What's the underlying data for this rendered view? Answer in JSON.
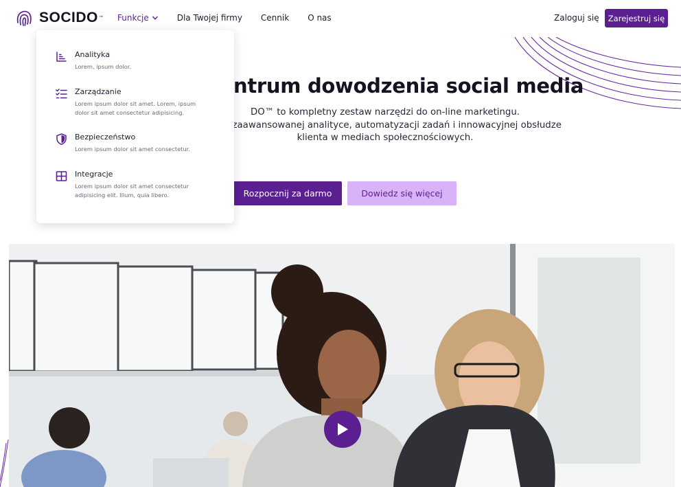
{
  "brand": {
    "name": "SOCIDO",
    "trademark": "™"
  },
  "nav": {
    "items": [
      {
        "label": "Funkcje"
      },
      {
        "label": "Dla Twojej firmy"
      },
      {
        "label": "Cennik"
      },
      {
        "label": "O nas"
      }
    ],
    "login_label": "Zaloguj się",
    "signup_label": "Zarejestruj się"
  },
  "dropdown": {
    "items": [
      {
        "title": "Analityka",
        "desc": "Lorem, ipsum dolor.",
        "icon": "chart-icon"
      },
      {
        "title": "Zarządzanie",
        "desc": "Lorem ipsum dolor sit amet. Lorem, ipsum dolor sit amet consectetur adipisicing.",
        "icon": "checklist-icon"
      },
      {
        "title": "Bezpieczeństwo",
        "desc": "Lorem ipsum dolor sit amet consectetur.",
        "icon": "shield-icon"
      },
      {
        "title": "Integracje",
        "desc": "Lorem ipsum dolor sit amet consectetur adipisicing elit. Illum, quia libero.",
        "icon": "grid-icon"
      }
    ]
  },
  "hero": {
    "title": "ntrum dowodzenia social media",
    "sub_line1": "DO™ to kompletny zestaw narzędzi do on-line marketingu.",
    "sub_line2": "zięki zaawansowanej analityce, automatyzacji zadań i innowacyjnej obsłudze",
    "sub_line3": "klienta w mediach społecznościowych.",
    "primary_cta": "Rozpocznij za darmo",
    "secondary_cta": "Dowiedz się więcej"
  },
  "colors": {
    "primary": "#5b1f91",
    "secondary": "#d9b3f7",
    "text": "#1f1b2d"
  }
}
